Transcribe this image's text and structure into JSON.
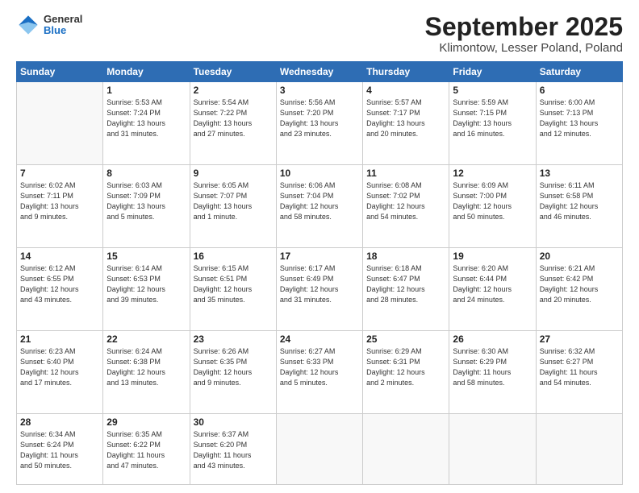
{
  "header": {
    "logo_general": "General",
    "logo_blue": "Blue",
    "month_title": "September 2025",
    "location": "Klimontow, Lesser Poland, Poland"
  },
  "weekdays": [
    "Sunday",
    "Monday",
    "Tuesday",
    "Wednesday",
    "Thursday",
    "Friday",
    "Saturday"
  ],
  "weeks": [
    [
      {
        "day": "",
        "info": ""
      },
      {
        "day": "1",
        "info": "Sunrise: 5:53 AM\nSunset: 7:24 PM\nDaylight: 13 hours\nand 31 minutes."
      },
      {
        "day": "2",
        "info": "Sunrise: 5:54 AM\nSunset: 7:22 PM\nDaylight: 13 hours\nand 27 minutes."
      },
      {
        "day": "3",
        "info": "Sunrise: 5:56 AM\nSunset: 7:20 PM\nDaylight: 13 hours\nand 23 minutes."
      },
      {
        "day": "4",
        "info": "Sunrise: 5:57 AM\nSunset: 7:17 PM\nDaylight: 13 hours\nand 20 minutes."
      },
      {
        "day": "5",
        "info": "Sunrise: 5:59 AM\nSunset: 7:15 PM\nDaylight: 13 hours\nand 16 minutes."
      },
      {
        "day": "6",
        "info": "Sunrise: 6:00 AM\nSunset: 7:13 PM\nDaylight: 13 hours\nand 12 minutes."
      }
    ],
    [
      {
        "day": "7",
        "info": "Sunrise: 6:02 AM\nSunset: 7:11 PM\nDaylight: 13 hours\nand 9 minutes."
      },
      {
        "day": "8",
        "info": "Sunrise: 6:03 AM\nSunset: 7:09 PM\nDaylight: 13 hours\nand 5 minutes."
      },
      {
        "day": "9",
        "info": "Sunrise: 6:05 AM\nSunset: 7:07 PM\nDaylight: 13 hours\nand 1 minute."
      },
      {
        "day": "10",
        "info": "Sunrise: 6:06 AM\nSunset: 7:04 PM\nDaylight: 12 hours\nand 58 minutes."
      },
      {
        "day": "11",
        "info": "Sunrise: 6:08 AM\nSunset: 7:02 PM\nDaylight: 12 hours\nand 54 minutes."
      },
      {
        "day": "12",
        "info": "Sunrise: 6:09 AM\nSunset: 7:00 PM\nDaylight: 12 hours\nand 50 minutes."
      },
      {
        "day": "13",
        "info": "Sunrise: 6:11 AM\nSunset: 6:58 PM\nDaylight: 12 hours\nand 46 minutes."
      }
    ],
    [
      {
        "day": "14",
        "info": "Sunrise: 6:12 AM\nSunset: 6:55 PM\nDaylight: 12 hours\nand 43 minutes."
      },
      {
        "day": "15",
        "info": "Sunrise: 6:14 AM\nSunset: 6:53 PM\nDaylight: 12 hours\nand 39 minutes."
      },
      {
        "day": "16",
        "info": "Sunrise: 6:15 AM\nSunset: 6:51 PM\nDaylight: 12 hours\nand 35 minutes."
      },
      {
        "day": "17",
        "info": "Sunrise: 6:17 AM\nSunset: 6:49 PM\nDaylight: 12 hours\nand 31 minutes."
      },
      {
        "day": "18",
        "info": "Sunrise: 6:18 AM\nSunset: 6:47 PM\nDaylight: 12 hours\nand 28 minutes."
      },
      {
        "day": "19",
        "info": "Sunrise: 6:20 AM\nSunset: 6:44 PM\nDaylight: 12 hours\nand 24 minutes."
      },
      {
        "day": "20",
        "info": "Sunrise: 6:21 AM\nSunset: 6:42 PM\nDaylight: 12 hours\nand 20 minutes."
      }
    ],
    [
      {
        "day": "21",
        "info": "Sunrise: 6:23 AM\nSunset: 6:40 PM\nDaylight: 12 hours\nand 17 minutes."
      },
      {
        "day": "22",
        "info": "Sunrise: 6:24 AM\nSunset: 6:38 PM\nDaylight: 12 hours\nand 13 minutes."
      },
      {
        "day": "23",
        "info": "Sunrise: 6:26 AM\nSunset: 6:35 PM\nDaylight: 12 hours\nand 9 minutes."
      },
      {
        "day": "24",
        "info": "Sunrise: 6:27 AM\nSunset: 6:33 PM\nDaylight: 12 hours\nand 5 minutes."
      },
      {
        "day": "25",
        "info": "Sunrise: 6:29 AM\nSunset: 6:31 PM\nDaylight: 12 hours\nand 2 minutes."
      },
      {
        "day": "26",
        "info": "Sunrise: 6:30 AM\nSunset: 6:29 PM\nDaylight: 11 hours\nand 58 minutes."
      },
      {
        "day": "27",
        "info": "Sunrise: 6:32 AM\nSunset: 6:27 PM\nDaylight: 11 hours\nand 54 minutes."
      }
    ],
    [
      {
        "day": "28",
        "info": "Sunrise: 6:34 AM\nSunset: 6:24 PM\nDaylight: 11 hours\nand 50 minutes."
      },
      {
        "day": "29",
        "info": "Sunrise: 6:35 AM\nSunset: 6:22 PM\nDaylight: 11 hours\nand 47 minutes."
      },
      {
        "day": "30",
        "info": "Sunrise: 6:37 AM\nSunset: 6:20 PM\nDaylight: 11 hours\nand 43 minutes."
      },
      {
        "day": "",
        "info": ""
      },
      {
        "day": "",
        "info": ""
      },
      {
        "day": "",
        "info": ""
      },
      {
        "day": "",
        "info": ""
      }
    ]
  ]
}
